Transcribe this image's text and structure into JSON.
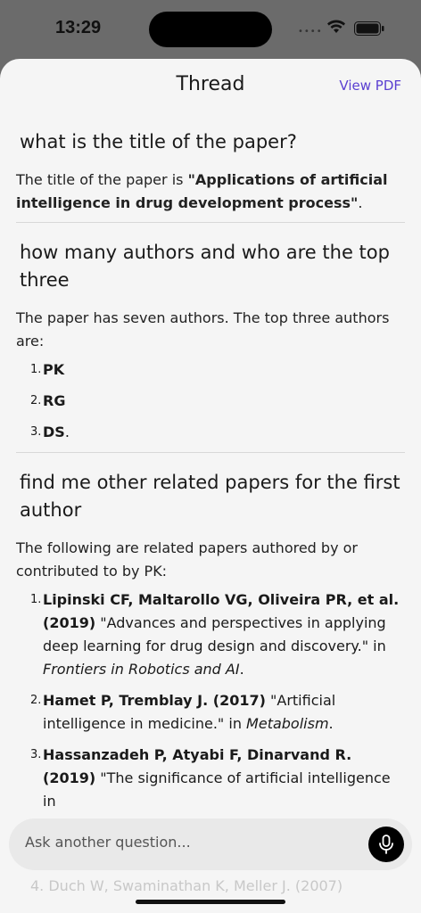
{
  "status": {
    "time": "13:29"
  },
  "header": {
    "title": "Thread",
    "view_pdf": "View PDF"
  },
  "qa": [
    {
      "question": "what is the title of the paper?",
      "answer_prefix": "The title of the paper is ",
      "answer_bold": "\"Applications of artificial intelligence in drug development process\"",
      "answer_suffix": "."
    },
    {
      "question": "how many authors and who are the top three",
      "answer": "The paper has seven authors. The top three authors are:",
      "items": [
        {
          "num": "1.",
          "bold": "PK",
          "rest": ""
        },
        {
          "num": "2.",
          "bold": "RG",
          "rest": ""
        },
        {
          "num": "3.",
          "bold": "DS",
          "rest": "."
        }
      ]
    },
    {
      "question": "find me other related papers for the first author",
      "answer": "The following are related papers authored by or contributed to by PK:",
      "items": [
        {
          "num": "1.",
          "bold": "Lipinski CF, Maltarollo VG, Oliveira PR, et al. (2019)",
          "rest": " \"Advances and perspectives in applying deep learning for drug design and discovery.\" in ",
          "italic": "Frontiers in Robotics and AI",
          "end": "."
        },
        {
          "num": "2.",
          "bold": "Hamet P, Tremblay J. (2017)",
          "rest": " \"Artificial intelligence in medicine.\" in ",
          "italic": "Metabolism",
          "end": "."
        },
        {
          "num": "3.",
          "bold": "Hassanzadeh P, Atyabi F, Dinarvand R. (2019)",
          "rest": " \"The significance of artificial intelligence in",
          "italic": "",
          "end": ""
        }
      ]
    }
  ],
  "ghost_item": "4. Duch W, Swaminathan K, Meller J. (2007)",
  "input": {
    "placeholder": "Ask another question..."
  },
  "icons": {
    "mic": "microphone-icon",
    "wifi": "wifi-icon",
    "battery": "battery-icon"
  }
}
